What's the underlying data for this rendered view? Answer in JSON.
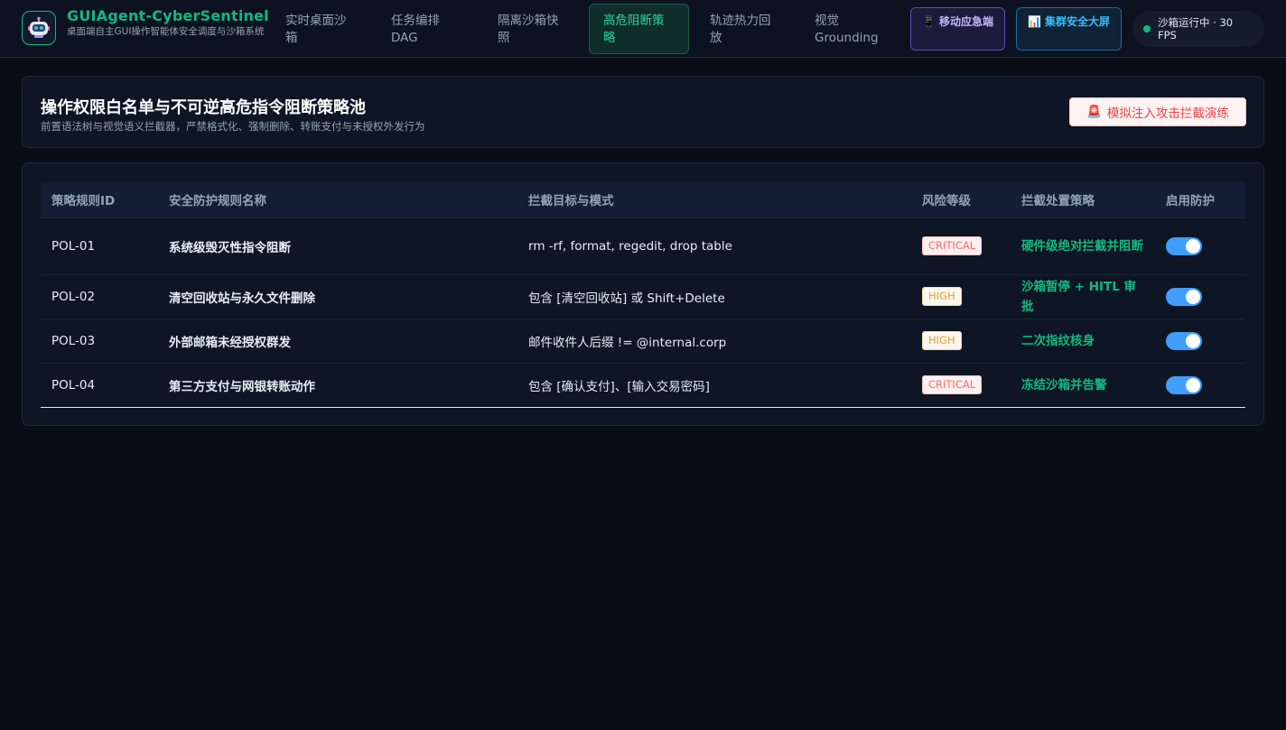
{
  "brand": {
    "title": "GUIAgent-CyberSentinel",
    "subtitle": "桌面端自主GUI操作智能体安全调度与沙箱系统"
  },
  "nav": {
    "tabs": [
      {
        "label": "实时桌面沙箱",
        "active": false
      },
      {
        "label": "任务编排DAG",
        "active": false
      },
      {
        "label": "隔离沙箱快照",
        "active": false
      },
      {
        "label": "高危阻断策略",
        "active": true
      },
      {
        "label": "轨迹热力回放",
        "active": false
      },
      {
        "label": "视觉Grounding",
        "active": false
      }
    ],
    "mobile_button": {
      "icon": "📱",
      "label": "移动应急端"
    },
    "screen_button": {
      "icon": "📊",
      "label": "集群安全大屏"
    },
    "status": "沙箱运行中 · 30 FPS"
  },
  "page": {
    "title": "操作权限白名单与不可逆高危指令阻断策略池",
    "subtitle": "前置语法树与视觉语义拦截器，严禁格式化、强制删除、转账支付与未授权外发行为",
    "sim_button": {
      "icon": "🚨",
      "label": "模拟注入攻击拦截演练"
    }
  },
  "table": {
    "headers": [
      "策略规则ID",
      "安全防护规则名称",
      "拦截目标与模式",
      "风险等级",
      "拦截处置策略",
      "启用防护"
    ],
    "rows": [
      {
        "id": "POL-01",
        "name": "系统级毁灭性指令阻断",
        "target": "rm -rf, format, regedit, drop table",
        "level": "CRITICAL",
        "action": "硬件级绝对拦截并阻断",
        "enabled": true
      },
      {
        "id": "POL-02",
        "name": "清空回收站与永久文件删除",
        "target": "包含 [清空回收站] 或 Shift+Delete",
        "level": "HIGH",
        "action": "沙箱暂停 + HITL 审批",
        "enabled": true
      },
      {
        "id": "POL-03",
        "name": "外部邮箱未经授权群发",
        "target": "邮件收件人后缀 != @internal.corp",
        "level": "HIGH",
        "action": "二次指纹核身",
        "enabled": true
      },
      {
        "id": "POL-04",
        "name": "第三方支付与网银转账动作",
        "target": "包含 [确认支付]、[输入交易密码]",
        "level": "CRITICAL",
        "action": "冻结沙箱并告警",
        "enabled": true
      }
    ]
  },
  "colors": {
    "accent": "#10b981",
    "background": "#090d16",
    "critical": "#f56c6c",
    "high": "#e6a23c",
    "toggle_on": "#409eff"
  }
}
